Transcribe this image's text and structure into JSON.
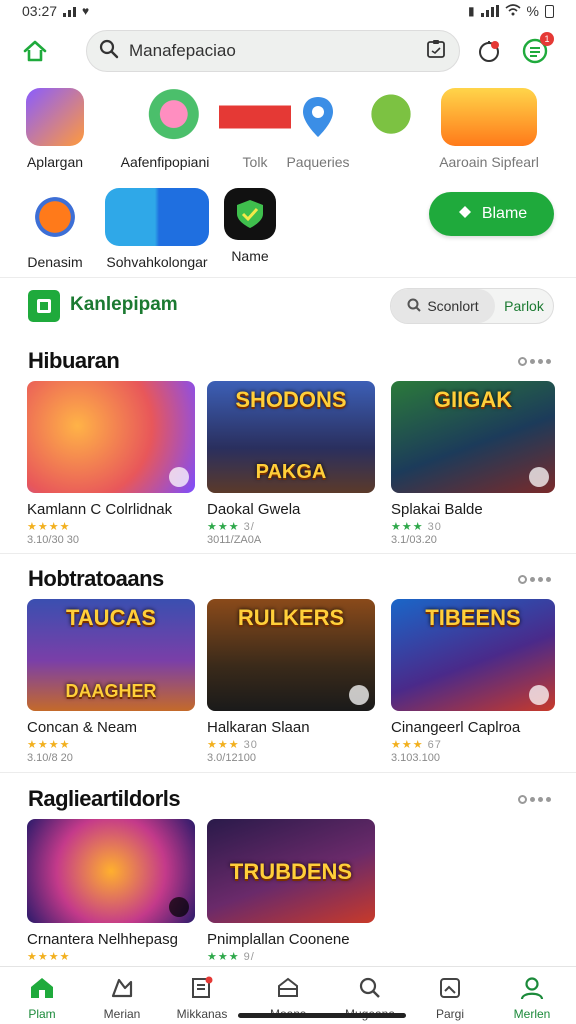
{
  "status": {
    "time": "03:27",
    "battery": "%"
  },
  "header": {
    "search_text": "Manafepaciao",
    "icons": [
      "home-icon",
      "search-icon",
      "clipboard-icon",
      "notification-icon",
      "menu-icon"
    ],
    "badge": "1"
  },
  "apps": {
    "row1": [
      {
        "label": "Aplargan",
        "icon": "character-app-icon"
      },
      {
        "label": "Aafenfipopiani",
        "icon": "fruit-app-icon"
      },
      {
        "label": "Tolk",
        "icon": "news-app-icon"
      },
      {
        "label": "Paqueries",
        "icon": "location-pin-icon"
      },
      {
        "label": "",
        "icon": "green-creature-icon"
      },
      {
        "label": "Aaroain Sipfearl",
        "icon": "game-logo-icon"
      }
    ],
    "row2": [
      {
        "label": "Denasim",
        "icon": "robot-app-icon"
      },
      {
        "label": "Sohvahkolongar",
        "icon": "folder-app-icon"
      },
      {
        "label": "Name",
        "icon": "shield-app-icon"
      }
    ],
    "play_button": "Blame"
  },
  "brand": {
    "name": "Kanlepipam",
    "segment_active": "Sconlort",
    "segment_other": "Parlok"
  },
  "sections": [
    {
      "title": "Hibuaran",
      "cards": [
        {
          "name": "Kamlann C Colrlidnak",
          "meta": "3.10/30 30",
          "art": "",
          "stars": "★★★★",
          "rating": ""
        },
        {
          "name": "Daokal Gwela",
          "meta": "3011/ZA0A",
          "art": "SHODONS",
          "subart": "PAKGA",
          "stars": "★★★",
          "rating": "3/"
        },
        {
          "name": "Splakai Balde",
          "meta": "3.1/03.20",
          "art": "GIIGAK",
          "stars": "★★★",
          "rating": "30"
        }
      ]
    },
    {
      "title": "Hobtratoaans",
      "cards": [
        {
          "name": "Concan & Neam",
          "meta": "3.10/8 20",
          "art": "TAUCAS",
          "subart": "DAAGHER",
          "stars": "★★★★",
          "rating": ""
        },
        {
          "name": "Halkaran Slaan",
          "meta": "3.0/12100",
          "art": "RULKERS",
          "stars": "★★★",
          "rating": "30"
        },
        {
          "name": "Cinangeerl Caplroa",
          "meta": "3.103.100",
          "art": "TIBEENS",
          "stars": "★★★",
          "rating": "67"
        }
      ]
    },
    {
      "title": "Raglieartildorls",
      "cards": [
        {
          "name": "Crnantera Nelhhepasg",
          "meta": "",
          "art": "",
          "stars": "★★★★",
          "rating": ""
        },
        {
          "name": "Pnimplallan Coonene",
          "meta": "",
          "art": "TRUBDENS",
          "stars": "★★★",
          "rating": "9/"
        }
      ]
    }
  ],
  "bottom_nav": [
    {
      "label": "Plam",
      "icon": "home-nav-icon",
      "active": true
    },
    {
      "label": "Merian",
      "icon": "map-nav-icon",
      "active": false
    },
    {
      "label": "Mikkanas",
      "icon": "apps-nav-icon",
      "active": false
    },
    {
      "label": "Moans",
      "icon": "store-nav-icon",
      "active": false
    },
    {
      "label": "Mugeana",
      "icon": "search-nav-icon",
      "active": false
    },
    {
      "label": "Pargi",
      "icon": "gallery-nav-icon",
      "active": false
    },
    {
      "label": "Merlen",
      "icon": "profile-nav-icon",
      "active": true
    }
  ],
  "colors": {
    "accent": "#1faa3c",
    "brand_text": "#1b7a31",
    "star": "#f2b01e",
    "star_green": "#2ea84a"
  }
}
